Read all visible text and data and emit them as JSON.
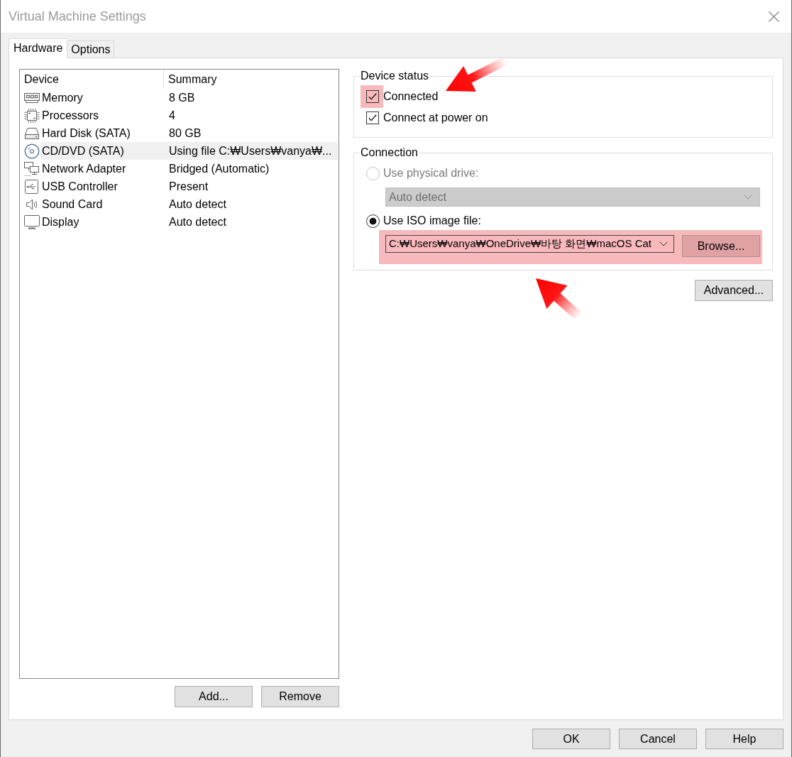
{
  "window": {
    "title": "Virtual Machine Settings"
  },
  "tabs": [
    {
      "label": "Hardware",
      "selected": true
    },
    {
      "label": "Options",
      "selected": false
    }
  ],
  "device_list": {
    "columns": [
      "Device",
      "Summary"
    ],
    "rows": [
      {
        "kind": "memory",
        "device": "Memory",
        "summary": "8 GB",
        "selected": false
      },
      {
        "kind": "processor",
        "device": "Processors",
        "summary": "4",
        "selected": false
      },
      {
        "kind": "hard_disk",
        "device": "Hard Disk (SATA)",
        "summary": "80 GB",
        "selected": false
      },
      {
        "kind": "cd_dvd",
        "device": "CD/DVD (SATA)",
        "summary": "Using file C:₩Users₩vanya₩...",
        "selected": true
      },
      {
        "kind": "network",
        "device": "Network Adapter",
        "summary": "Bridged (Automatic)",
        "selected": false
      },
      {
        "kind": "usb",
        "device": "USB Controller",
        "summary": "Present",
        "selected": false
      },
      {
        "kind": "sound",
        "device": "Sound Card",
        "summary": "Auto detect",
        "selected": false
      },
      {
        "kind": "display",
        "device": "Display",
        "summary": "Auto detect",
        "selected": false
      }
    ]
  },
  "list_buttons": [
    "Add...",
    "Remove"
  ],
  "device_status": {
    "title": "Device status",
    "options": [
      {
        "label": "Connected",
        "checked": true,
        "highlighted": true
      },
      {
        "label": "Connect at power on",
        "checked": true,
        "highlighted": false
      }
    ]
  },
  "connection": {
    "title": "Connection",
    "sources": [
      {
        "kind": "drive",
        "label": "Use physical drive:",
        "selected": false,
        "disabled": true,
        "value": "Auto detect",
        "highlighted": false
      },
      {
        "kind": "iso",
        "label": "Use ISO image file:",
        "selected": true,
        "disabled": false,
        "value": "C:₩Users₩vanya₩OneDrive₩바탕 화면₩macOS Cat",
        "button": "Browse...",
        "highlighted": true
      }
    ]
  },
  "advanced_button": "Advanced...",
  "dialog_buttons": [
    "OK",
    "Cancel",
    "Help"
  ]
}
